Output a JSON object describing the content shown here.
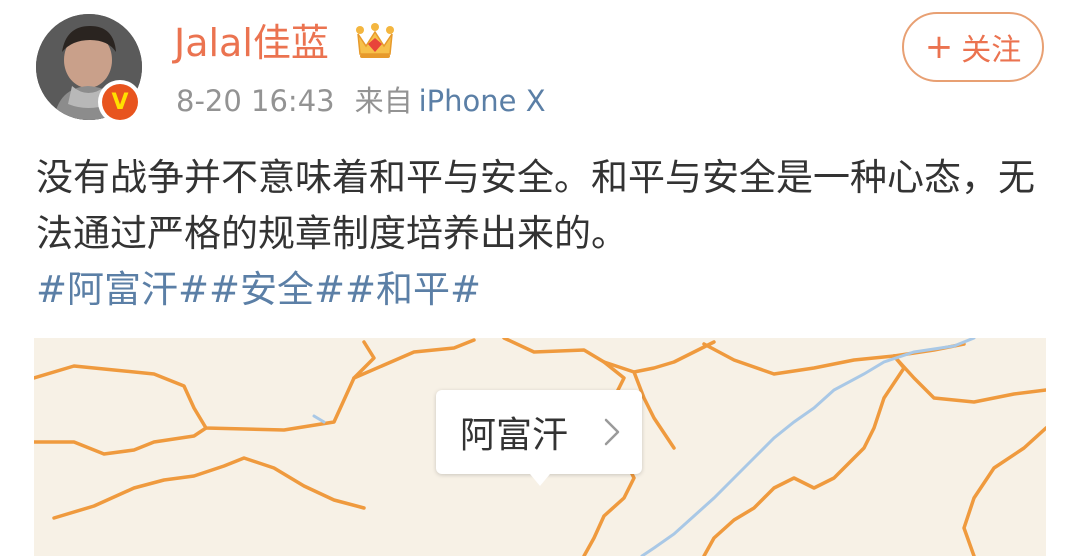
{
  "user": {
    "name": "Jalal佳蓝",
    "avatar_icon": "avatar-photo",
    "badge_icon": "verified-v-badge",
    "badge_text": "V",
    "crown_icon": "crown-icon"
  },
  "meta": {
    "timestamp": "8-20 16:43",
    "source_label": "来自",
    "device": "iPhone X"
  },
  "follow": {
    "plus": "+",
    "label": "关注"
  },
  "post": {
    "text": "没有战争并不意味着和平与安全。和平与安全是一种心态，无法通过严格的规章制度培养出来的。",
    "hashtags": [
      "#阿富汗#",
      "#安全#",
      "#和平#"
    ]
  },
  "map": {
    "location_label": "阿富汗",
    "chevron_icon": "chevron-right-icon"
  },
  "colors": {
    "username": "#eb7350",
    "link": "#5b7fa6",
    "meta": "#939393",
    "map_background": "#f7f1e6",
    "border_line": "#ef9a3e",
    "river": "#a9c8e6"
  }
}
